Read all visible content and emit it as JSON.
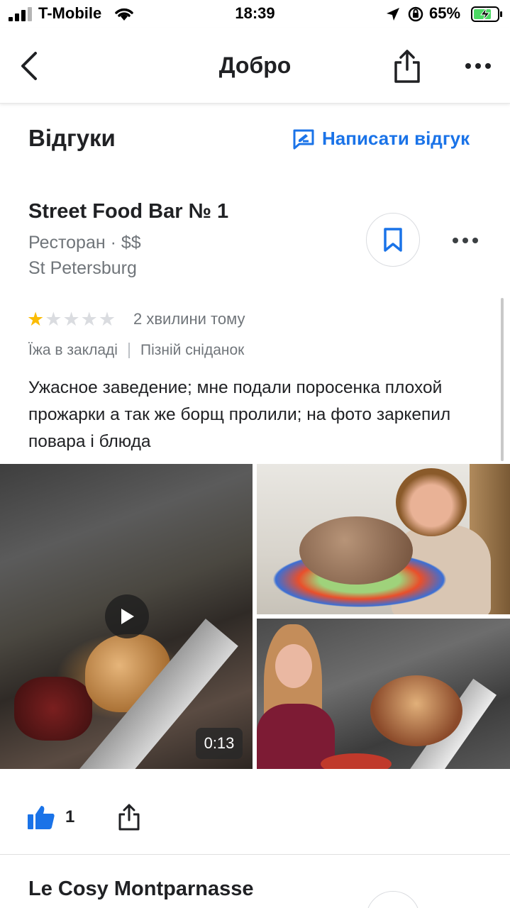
{
  "status_bar": {
    "carrier": "T-Mobile",
    "time": "18:39",
    "battery": "65%"
  },
  "header": {
    "title": "Добро"
  },
  "reviews_section": {
    "title": "Відгуки",
    "write_label": "Написати відгук"
  },
  "place": {
    "name": "Street Food Bar № 1",
    "category": "Ресторан · $$",
    "city": "St Petersburg"
  },
  "review": {
    "rating": 1,
    "max_rating": 5,
    "time_ago": "2 хвилини тому",
    "tags": [
      "Їжа в закладі",
      "Пізній сніданок"
    ],
    "text": "Ужасное заведение; мне подали поросенка плохой прожарки а так же борщ пролили; на фото заркепил повара і блюда",
    "video_duration": "0:13",
    "likes": "1"
  },
  "next_place": {
    "name": "Le Cosy Montparnasse"
  },
  "colors": {
    "accent": "#1a73e8",
    "star_filled": "#fbbc04",
    "star_empty": "#dadce0",
    "secondary_text": "#70757a"
  },
  "icons": {
    "back": "chevron-left-icon",
    "share": "share-icon",
    "more": "more-horizontal-icon",
    "write": "rate-review-icon",
    "bookmark": "bookmark-icon",
    "play": "play-icon",
    "like": "thumbs-up-icon"
  }
}
